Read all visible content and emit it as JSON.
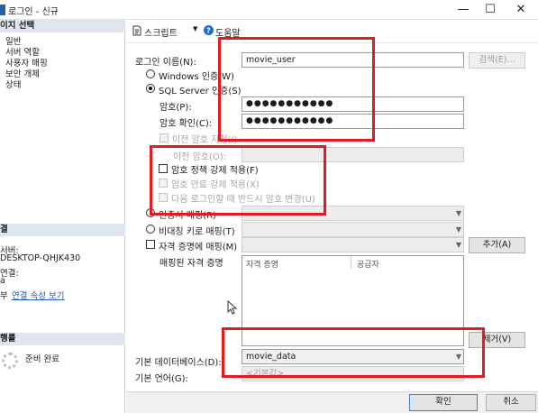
{
  "window": {
    "title": "로그인 - 신규",
    "minimize": "—",
    "maximize": "☐",
    "close": "✕"
  },
  "left": {
    "pages_header": "이지 선택",
    "pages": [
      "일반",
      "서버 역할",
      "사용자 매핑",
      "보안 개체",
      "상태"
    ],
    "connection_header": "결",
    "server_label": "서버:",
    "server_value": "DESKTOP-QHJK430",
    "connection_label": "연결:",
    "connection_value": "a",
    "view_props_prefix": "부",
    "view_props_link": "연결 속성 보기",
    "progress_header": "행률",
    "progress_status": "준비 완료"
  },
  "toolbar": {
    "script_label": "스크립트",
    "help_label": "도움말"
  },
  "form": {
    "login_name_label": "로그인 이름(N):",
    "login_name_value": "movie_user",
    "search_button": "검색(E)...",
    "windows_auth_label": "Windows 인증(W)",
    "sql_auth_label": "SQL Server 인증(S)",
    "password_label": "암호(P):",
    "password_value": "●●●●●●●●●●●",
    "confirm_label": "암호 확인(C):",
    "confirm_value": "●●●●●●●●●●●",
    "old_password_check": "이전 암호 지정(I)",
    "old_password_label": "이전 암호(O):",
    "enforce_policy_label": "암호 정책 강제 적용(F)",
    "enforce_expiration_label": "암호 만료 강제 적용(X)",
    "must_change_label": "다음 로그인할 때 반드시 암호 변경(U)",
    "cert_mapped_label": "인증서 매핑(R)",
    "asym_key_label": "비대칭 키로 매핑(T)",
    "credential_label": "자격 증명에 매핑(M)",
    "add_button": "추가(A)",
    "mapped_creds_label": "매핑된 자격 증명",
    "grid_col_credential": "자격 증명",
    "grid_col_provider": "공급자",
    "remove_button": "제거(V)",
    "default_db_label": "기본 데이터베이스(D):",
    "default_db_value": "movie_data",
    "default_lang_label": "기본 언어(G):",
    "default_lang_value": "<기본값>"
  },
  "footer": {
    "ok_button": "확인",
    "cancel_button": "취소"
  }
}
